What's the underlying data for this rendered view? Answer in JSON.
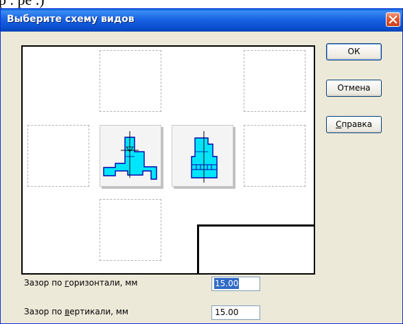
{
  "window": {
    "title": "Выберите схему видов",
    "close_icon": "close-icon"
  },
  "background_text": "р  .                                   ре  .)",
  "preview": {
    "slots": [
      {
        "id": "top",
        "state": "empty"
      },
      {
        "id": "top-right",
        "state": "empty"
      },
      {
        "id": "left",
        "state": "empty"
      },
      {
        "id": "front",
        "state": "active",
        "icon": "part-front-view"
      },
      {
        "id": "side",
        "state": "active",
        "icon": "part-side-view"
      },
      {
        "id": "right",
        "state": "empty"
      },
      {
        "id": "bottom",
        "state": "empty"
      }
    ],
    "view_fill_color": "#00e5ff"
  },
  "buttons": {
    "ok": "ОК",
    "cancel": "Отмена",
    "help_accel": "С",
    "help_rest": "правка"
  },
  "fields": {
    "horizontal": {
      "label_before": "Зазор по ",
      "label_accel": "г",
      "label_after": "оризонтали, мм",
      "value": "15.00",
      "selected": true
    },
    "vertical": {
      "label_before": "Зазор по ",
      "label_accel": "в",
      "label_after": "ертикали, мм",
      "value": "15.00",
      "selected": false
    }
  }
}
